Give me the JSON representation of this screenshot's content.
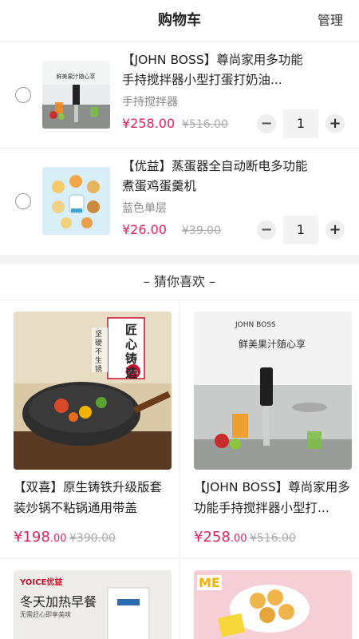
{
  "header": {
    "title": "购物车",
    "manage_label": "管理"
  },
  "cart": {
    "items": [
      {
        "title": "【JOHN BOSS】尊尚家用多功能手持搅拌器小型打蛋打奶油...",
        "spec": "手持搅拌器",
        "price": "¥258.00",
        "old_price": "¥516.00",
        "quantity": "1",
        "selected": false
      },
      {
        "title": "【优益】蒸蛋器全自动断电多功能煮蛋鸡蛋羹机",
        "spec": "蓝色单层",
        "price": "¥26.00",
        "old_price": "¥39.00",
        "quantity": "1",
        "selected": false
      }
    ],
    "minus_glyph": "−",
    "plus_glyph": "+"
  },
  "recommend": {
    "title": "– 猜你喜欢 –",
    "cards": [
      {
        "title": "【双喜】原生铸铁升级版套装炒锅不粘锅通用带盖",
        "price_main": "¥198",
        "price_cents": ".00",
        "old_price": "¥390.00",
        "image_text": [
          "匠心铸造",
          "坚硬不生锈",
          "新品"
        ]
      },
      {
        "title": "【JOHN BOSS】尊尚家用多功能手持搅拌器小型打...",
        "price_main": "¥258",
        "price_cents": ".00",
        "old_price": "¥516.00",
        "image_text": [
          "JOHN BOSS",
          "鲜美果汁随心享"
        ]
      },
      {
        "title": "",
        "image_text": [
          "YOICE优益",
          "冬天加热早餐",
          "无需赶心即享美味"
        ]
      },
      {
        "title": "",
        "image_text": [
          "ME"
        ]
      }
    ]
  },
  "colors": {
    "accent": "#e0245e"
  }
}
